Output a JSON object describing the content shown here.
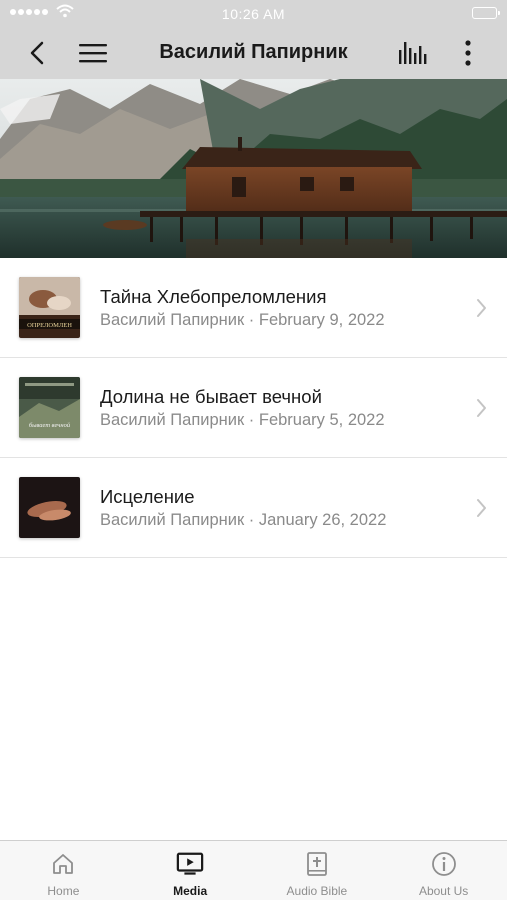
{
  "status_bar": {
    "time": "10:26 AM"
  },
  "header": {
    "title": "Василий Папирник"
  },
  "icons": {
    "back": "chevron-left-icon",
    "menu": "hamburger-menu-icon",
    "stats": "audio-levels-icon",
    "more": "more-vertical-icon",
    "row_chevron": "chevron-right-icon"
  },
  "media_items": [
    {
      "title": "Тайна Хлебопреломления",
      "subtitle": "Василий Папирник · February 9, 2022",
      "thumb_text": "ОПРЕЛОМЛЕН"
    },
    {
      "title": "Долина не бывает вечной",
      "subtitle": "Василий Папирник · February 5, 2022",
      "thumb_text": "бывает вечной"
    },
    {
      "title": "Исцеление",
      "subtitle": "Василий Папирник · January 26, 2022"
    }
  ],
  "tabs": [
    {
      "label": "Home",
      "icon": "home-icon"
    },
    {
      "label": "Media",
      "icon": "media-tv-icon"
    },
    {
      "label": "Audio Bible",
      "icon": "bible-icon"
    },
    {
      "label": "About Us",
      "icon": "info-icon"
    }
  ],
  "colors": {
    "bar": "#d6d6d6",
    "tab_active": "#1a1a1a",
    "tab_inactive": "#8e8e8e"
  }
}
